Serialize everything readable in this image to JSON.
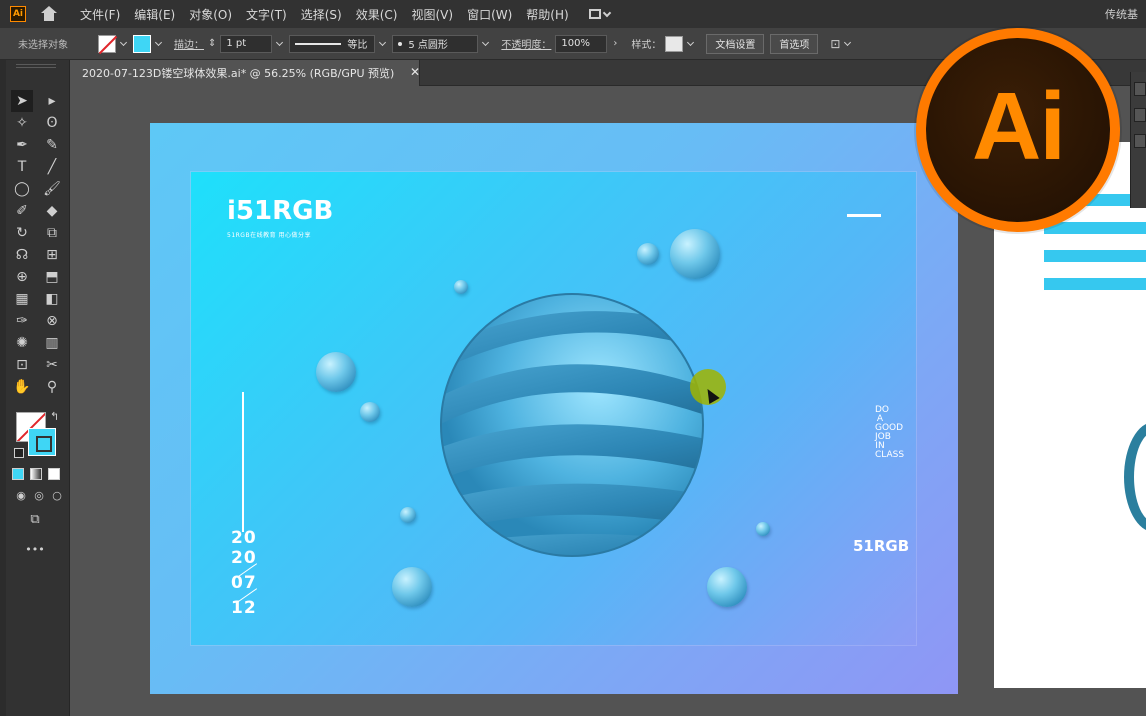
{
  "menu": {
    "app_icon": "Ai",
    "items": [
      "文件(F)",
      "编辑(E)",
      "对象(O)",
      "文字(T)",
      "选择(S)",
      "效果(C)",
      "视图(V)",
      "窗口(W)",
      "帮助(H)"
    ],
    "workspace_label": "传统基"
  },
  "control": {
    "no_selection": "未选择对象",
    "stroke_label": "描边：",
    "stroke_weight": "1 pt",
    "stroke_profile": "等比",
    "brush": "5 点圆形",
    "opacity_label": "不透明度：",
    "opacity_value": "100%",
    "style_label": "样式：",
    "doc_setup_btn": "文档设置",
    "prefs_btn": "首选项"
  },
  "tab": {
    "title": "2020-07-123D镂空球体效果.ai* @ 56.25% (RGB/GPU 预览)",
    "close": "✕"
  },
  "tools": {
    "more": "•••"
  },
  "poster": {
    "logo": "i51RGB",
    "logo_sub": "51RGB在线教育  用心做分享",
    "date_lines": [
      "20",
      "20",
      "07",
      "12"
    ],
    "slogan_vertical": "DO A GOOD JOB IN CLASS",
    "brand_vertical": "51RGB"
  },
  "badge": {
    "text": "Ai"
  },
  "colors": {
    "accent_cyan": "#3fd6f5",
    "ai_orange": "#ff7a00",
    "ai_dark": "#2a1504"
  }
}
